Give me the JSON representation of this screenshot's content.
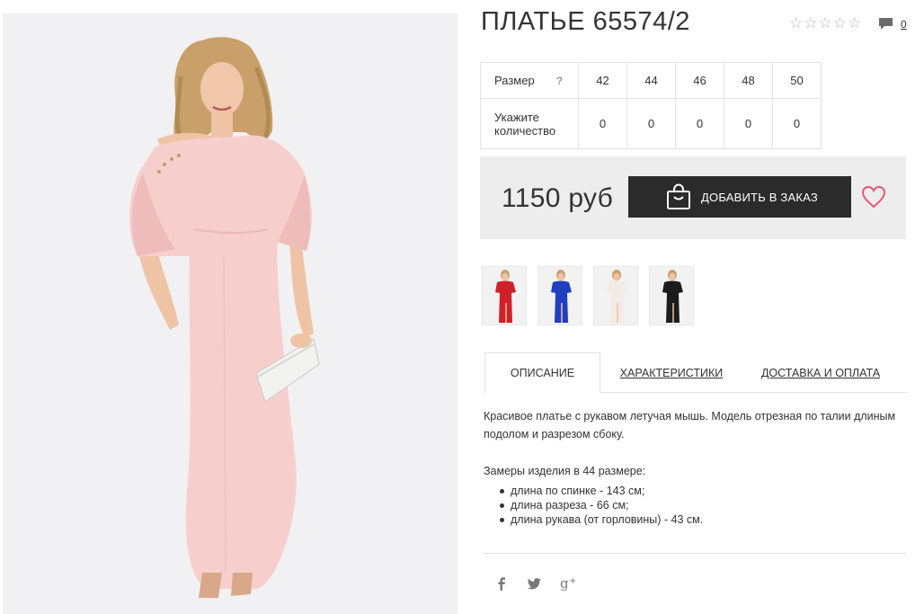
{
  "product": {
    "title": "ПЛАТЬЕ 65574/2",
    "rating_icon": "star-outline-icon",
    "rating_max": 5,
    "rating_value": 0,
    "comments_count": "0"
  },
  "sizes": {
    "size_label": "Размер",
    "help_mark": "?",
    "qty_label": "Укажите количество",
    "columns": [
      "42",
      "44",
      "46",
      "48",
      "50"
    ],
    "quantities": [
      "0",
      "0",
      "0",
      "0",
      "0"
    ]
  },
  "purchase": {
    "price": "1150 руб",
    "add_button_label": "ДОБАВИТЬ В ЗАКАЗ",
    "bag_icon": "shopping-bag-icon",
    "wishlist_icon": "heart-icon"
  },
  "variants": [
    {
      "name": "red",
      "color": "#d0202a"
    },
    {
      "name": "blue",
      "color": "#1f3fc1"
    },
    {
      "name": "light",
      "color": "#f4eae6"
    },
    {
      "name": "black",
      "color": "#1c1c1c"
    }
  ],
  "tabs": [
    {
      "label": "ОПИСАНИЕ",
      "active": true
    },
    {
      "label": "ХАРАКТЕРИСТИКИ",
      "active": false
    },
    {
      "label": "ДОСТАВКА И ОПЛАТА",
      "active": false
    }
  ],
  "description": {
    "text": "Красивое платье с рукавом летучая мышь. Модель отрезная по талии длиным подолом и разрезом сбоку.",
    "measures_title": "Замеры изделия в 44 размере:",
    "measures": [
      "длина по спинке - 143 см;",
      "длина разреза - 66 см;",
      "длина рукава (от горловины) - 43 см."
    ]
  },
  "social": [
    {
      "icon": "facebook-icon",
      "glyph": "f"
    },
    {
      "icon": "twitter-icon",
      "glyph": "t"
    },
    {
      "icon": "google-plus-icon",
      "glyph": "g+"
    }
  ],
  "colors": {
    "dress": "#f6cfcd",
    "photo_bg": "#f1f0f2",
    "button_bg": "#2b2b2b",
    "heart": "#e35a72",
    "price_bg": "#ededed"
  }
}
